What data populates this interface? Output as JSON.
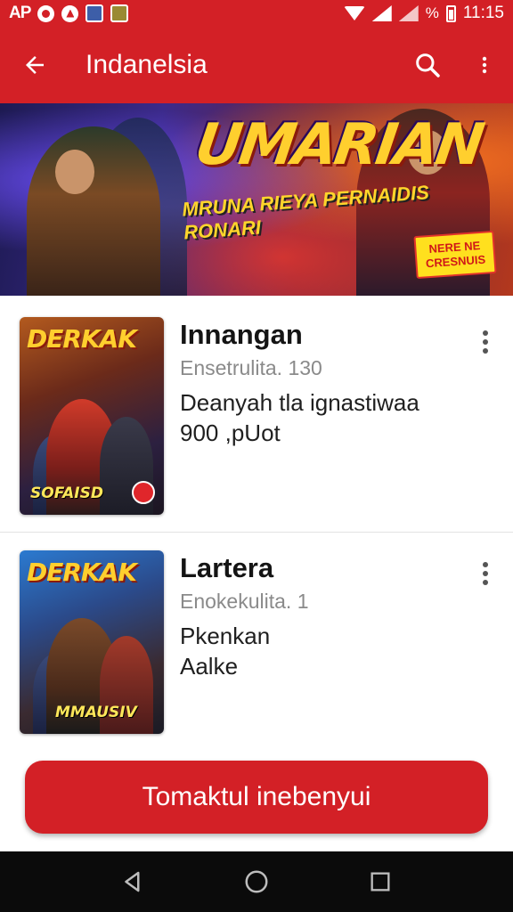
{
  "status_bar": {
    "carrier": "AP",
    "battery_text": "%",
    "time": "11:15"
  },
  "app_bar": {
    "title": "Indanelsia",
    "back_icon": "arrow-left-icon",
    "search_icon": "search-icon",
    "menu_icon": "more-vert-icon"
  },
  "banner": {
    "logo": "UMARIAN",
    "tagline": "MRUNA RIEYA PERNAIDIS RONARI",
    "badge": "NERE NE CRESNUIS"
  },
  "items": [
    {
      "title": "Innangan",
      "subtitle": "Ensetrulita. 130",
      "line1": "Deanyah tla ignastiwaa",
      "line2": "900 ,pUot",
      "thumb_logo": "DERKAK",
      "thumb_caption": "SOFAISD"
    },
    {
      "title": "Lartera",
      "subtitle": "Enokekulita. 1",
      "line1": "Pkenkan",
      "line2": "Aalke",
      "thumb_logo": "DERKAK",
      "thumb_caption": "MMAUSIV"
    }
  ],
  "cta": {
    "label": "Tomaktul inebenyui"
  },
  "colors": {
    "accent": "#d32026",
    "nav_background": "#0b0b0b"
  }
}
